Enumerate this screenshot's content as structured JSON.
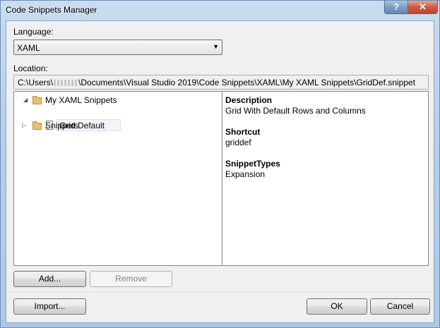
{
  "window": {
    "title": "Code Snippets Manager"
  },
  "caption_buttons": {
    "help": "?",
    "close": "✕"
  },
  "language": {
    "label": "Language:",
    "selected": "XAML",
    "arrow": "▼"
  },
  "location": {
    "label": "Location:",
    "prefix": "C:\\Users\\",
    "suffix": "\\Documents\\Visual Studio 2019\\Code Snippets\\XAML\\My XAML Snippets\\GridDef.snippet"
  },
  "tree": {
    "items": [
      {
        "label": "My XAML Snippets",
        "expander": "◢",
        "icon": "folder-open-icon"
      },
      {
        "label": "Grid Default",
        "icon": "snippet-file-icon"
      },
      {
        "label": "Snippets",
        "expander": "▷",
        "icon": "folder-icon"
      }
    ]
  },
  "details": {
    "description_label": "Description",
    "description_value": "Grid With Default Rows and Columns",
    "shortcut_label": "Shortcut",
    "shortcut_value": "griddef",
    "types_label": "SnippetTypes",
    "types_value": "Expansion"
  },
  "buttons": {
    "add": "Add...",
    "remove": "Remove",
    "import": "Import...",
    "ok": "OK",
    "cancel": "Cancel"
  }
}
